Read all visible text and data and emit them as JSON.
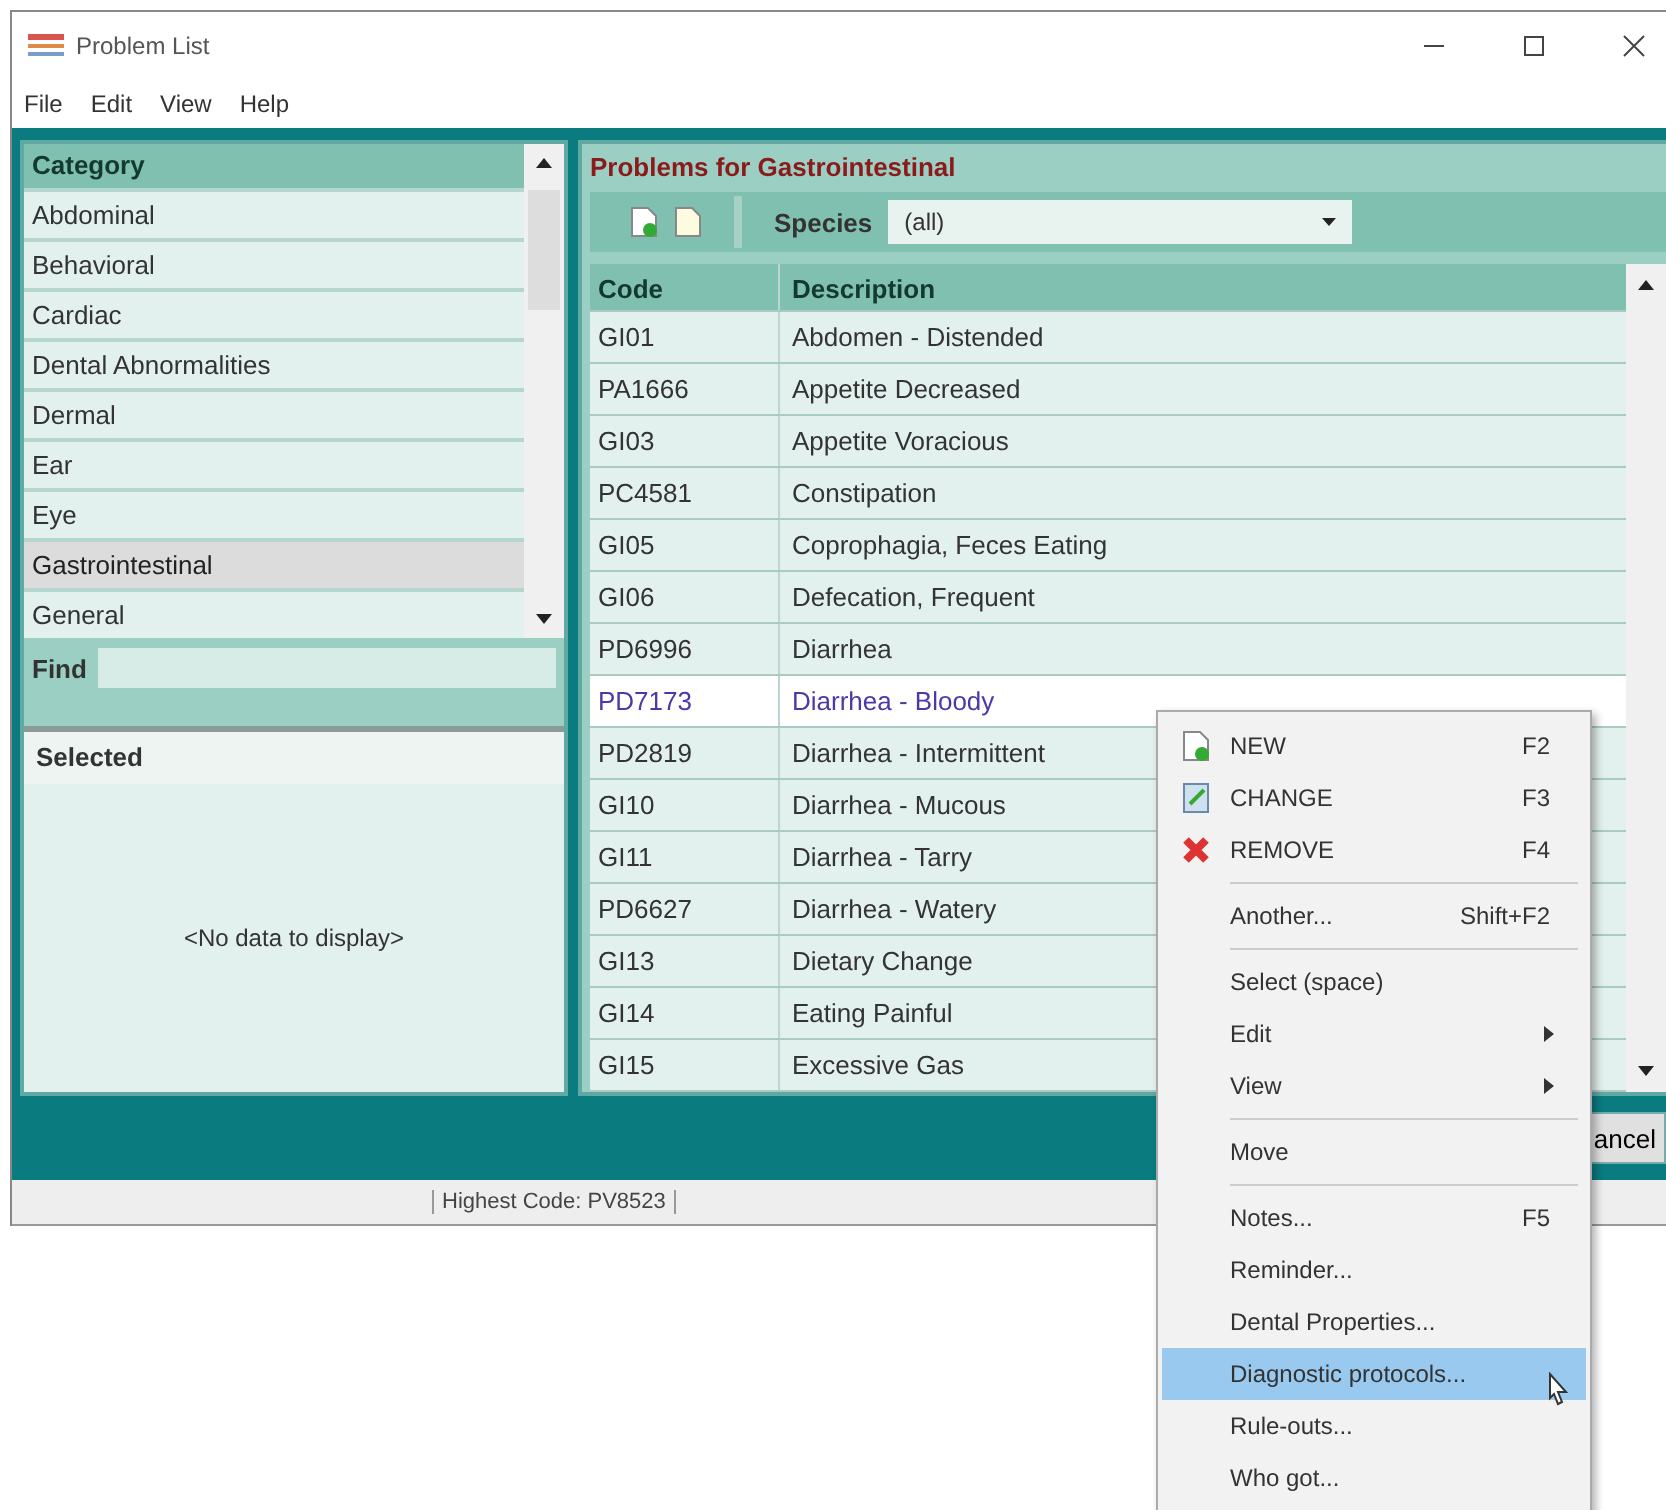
{
  "window": {
    "title": "Problem List"
  },
  "menu_bar": [
    "File",
    "Edit",
    "View",
    "Help"
  ],
  "category_list": {
    "header": "Category",
    "items": [
      {
        "label": "Abdominal",
        "selected": false
      },
      {
        "label": "Behavioral",
        "selected": false
      },
      {
        "label": "Cardiac",
        "selected": false
      },
      {
        "label": "Dental Abnormalities",
        "selected": false
      },
      {
        "label": "Dermal",
        "selected": false
      },
      {
        "label": "Ear",
        "selected": false
      },
      {
        "label": "Eye",
        "selected": false
      },
      {
        "label": "Gastrointestinal",
        "selected": true
      },
      {
        "label": "General",
        "selected": false
      }
    ]
  },
  "find": {
    "label": "Find"
  },
  "selected_panel": {
    "header": "Selected",
    "empty_text": "<No data to display>"
  },
  "problems": {
    "title": "Problems for Gastrointestinal",
    "species_label": "Species",
    "species_value": "(all)",
    "columns": [
      "Code",
      "Description"
    ],
    "rows": [
      {
        "code": "GI01",
        "description": "Abdomen - Distended",
        "selected": false
      },
      {
        "code": "PA1666",
        "description": "Appetite Decreased",
        "selected": false
      },
      {
        "code": "GI03",
        "description": "Appetite Voracious",
        "selected": false
      },
      {
        "code": "PC4581",
        "description": "Constipation",
        "selected": false
      },
      {
        "code": "GI05",
        "description": "Coprophagia, Feces Eating",
        "selected": false
      },
      {
        "code": "GI06",
        "description": "Defecation, Frequent",
        "selected": false
      },
      {
        "code": "PD6996",
        "description": "Diarrhea",
        "selected": false
      },
      {
        "code": "PD7173",
        "description": "Diarrhea - Bloody",
        "selected": true
      },
      {
        "code": "PD2819",
        "description": "Diarrhea - Intermittent",
        "selected": false
      },
      {
        "code": "GI10",
        "description": "Diarrhea - Mucous",
        "selected": false
      },
      {
        "code": "GI11",
        "description": "Diarrhea - Tarry",
        "selected": false
      },
      {
        "code": "PD6627",
        "description": "Diarrhea - Watery",
        "selected": false
      },
      {
        "code": "GI13",
        "description": "Dietary Change",
        "selected": false
      },
      {
        "code": "GI14",
        "description": "Eating Painful",
        "selected": false
      },
      {
        "code": "GI15",
        "description": "Excessive Gas",
        "selected": false
      }
    ]
  },
  "cancel_button": "ancel",
  "status_bar": "Highest Code: PV8523",
  "context_menu": {
    "groups": [
      [
        {
          "kind": "new",
          "label": "NEW",
          "shortcut": "F2",
          "submenu": false,
          "selected": false
        },
        {
          "kind": "change",
          "label": "CHANGE",
          "shortcut": "F3",
          "submenu": false,
          "selected": false
        },
        {
          "kind": "remove",
          "label": "REMOVE",
          "shortcut": "F4",
          "submenu": false,
          "selected": false
        }
      ],
      [
        {
          "kind": "plain",
          "label": "Another...",
          "shortcut": "Shift+F2",
          "submenu": false,
          "selected": false
        }
      ],
      [
        {
          "kind": "plain",
          "label": "Select (space)",
          "submenu": false,
          "selected": false
        },
        {
          "kind": "plain",
          "label": "Edit",
          "submenu": true,
          "selected": false
        },
        {
          "kind": "plain",
          "label": "View",
          "submenu": true,
          "selected": false
        }
      ],
      [
        {
          "kind": "plain",
          "label": "Move",
          "submenu": false,
          "selected": false
        }
      ],
      [
        {
          "kind": "plain",
          "label": "Notes...",
          "shortcut": "F5",
          "submenu": false,
          "selected": false
        },
        {
          "kind": "plain",
          "label": "Reminder...",
          "submenu": false,
          "selected": false
        },
        {
          "kind": "plain",
          "label": "Dental Properties...",
          "submenu": false,
          "selected": false
        },
        {
          "kind": "plain",
          "label": "Diagnostic protocols...",
          "submenu": false,
          "selected": true
        },
        {
          "kind": "plain",
          "label": "Rule-outs...",
          "submenu": false,
          "selected": false
        },
        {
          "kind": "plain",
          "label": "Who got...",
          "submenu": false,
          "selected": false
        }
      ]
    ]
  }
}
